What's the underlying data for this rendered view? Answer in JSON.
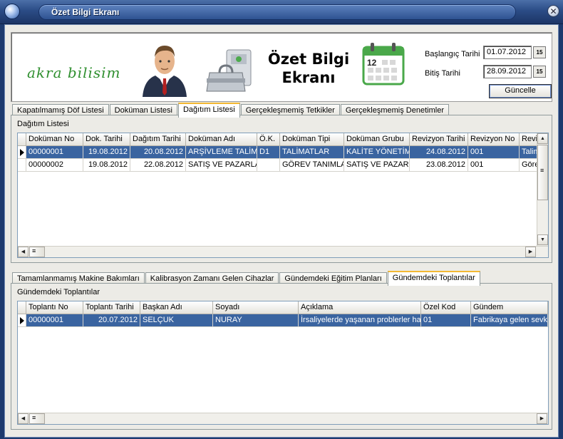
{
  "window": {
    "title": "Özet Bilgi Ekranı",
    "close_glyph": "✕"
  },
  "header": {
    "logo": "akra bilisim",
    "title_line1": "Özet Bilgi",
    "title_line2": "Ekranı",
    "calendar_day": "12",
    "start_label": "Başlangıç Tarihi",
    "start_value": "01.07.2012",
    "end_label": "Bitiş Tarihi",
    "end_value": "28.09.2012",
    "date_btn_glyph": "15",
    "update_label": "Güncelle"
  },
  "top_tabs": [
    {
      "label": "Kapatılmamış Döf Listesi",
      "active": false
    },
    {
      "label": "Doküman Listesi",
      "active": false
    },
    {
      "label": "Dağıtım Listesi",
      "active": true
    },
    {
      "label": "Gerçekleşmemiş Tetkikler",
      "active": false
    },
    {
      "label": "Gerçekleşmemiş Denetimler",
      "active": false
    }
  ],
  "top_group_label": "Dağıtım Listesi",
  "top_grid": {
    "columns": [
      "Doküman No",
      "Dok. Tarihi",
      "Dağıtım Tarihi",
      "Doküman Adı",
      "Ö.K.",
      "Doküman Tipi",
      "Doküman Grubu",
      "Revizyon Tarihi",
      "Revizyon No",
      "Revizyo"
    ],
    "rows": [
      [
        "00000001",
        "19.08.2012",
        "20.08.2012",
        "ARŞİVLEME TALİMA",
        "D1",
        "TALİMATLAR",
        "KALİTE YÖNETİM",
        "24.08.2012",
        "001",
        "Talima"
      ],
      [
        "00000002",
        "19.08.2012",
        "22.08.2012",
        "SATIŞ VE PAZARLA",
        "",
        "GÖREV TANIMLA",
        "SATIŞ VE PAZAR",
        "23.08.2012",
        "001",
        "Görev"
      ]
    ]
  },
  "bottom_tabs": [
    {
      "label": "Tamamlanmamış Makine Bakımları",
      "active": false
    },
    {
      "label": "Kalibrasyon Zamanı Gelen Cihazlar",
      "active": false
    },
    {
      "label": "Gündemdeki Eğitim Planları",
      "active": false
    },
    {
      "label": "Gündemdeki Toplantılar",
      "active": true
    }
  ],
  "bottom_group_label": "Gündemdeki Toplantılar",
  "bottom_grid": {
    "columns": [
      "Toplantı No",
      "Toplantı Tarihi",
      "Başkan Adı",
      "Soyadı",
      "Açıklama",
      "Özel Kod",
      "Gündem"
    ],
    "rows": [
      [
        "00000001",
        "20.07.2012",
        "SELÇUK",
        "NURAY",
        "İrsaliyelerde yaşanan problerler hakk",
        "01",
        "Fabrikaya gelen sevk i"
      ]
    ]
  },
  "scroll_glyphs": {
    "up": "▲",
    "down": "▼",
    "left": "◀",
    "right": "▶",
    "grip": "≡"
  },
  "colors": {
    "selection": "#3a64a0",
    "titlebar": "#2b4c86",
    "window_bg": "#ecebe6",
    "active_tab_accent": "#f3b833"
  }
}
